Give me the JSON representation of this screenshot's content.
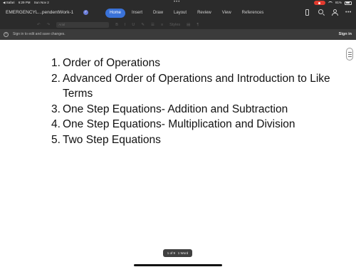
{
  "status_bar": {
    "app": "◀ Safari",
    "time": "6:29 PM",
    "date": "Sun Nov 2",
    "battery": "81%"
  },
  "title_bar": {
    "doc_title": "EMERGENCYL...pendentWork-1",
    "tabs": [
      "Home",
      "Insert",
      "Draw",
      "Layout",
      "Review",
      "View",
      "References"
    ],
    "active_tab": "Home"
  },
  "toolbar": {
    "font_name": "Arial",
    "bold": "B",
    "italic": "I",
    "underline": "U",
    "styles": "Styles"
  },
  "banner": {
    "message": "Sign in to edit and save changes.",
    "sign_in": "Sign in"
  },
  "document": {
    "items": [
      {
        "num": "1.",
        "text": "Order of Operations"
      },
      {
        "num": "2.",
        "text": "Advanced Order of Operations and Introduction to Like Terms"
      },
      {
        "num": "3.",
        "text": "One Step Equations- Addition and Subtraction"
      },
      {
        "num": "4.",
        "text": "One Step Equations- Multiplication and Division"
      },
      {
        "num": "5.",
        "text": "Two Step Equations"
      }
    ]
  },
  "page_count": {
    "label": "1 of 9",
    "words": "1 Word"
  },
  "colors": {
    "accent": "#3a72d8",
    "chrome": "#2b2b2b",
    "banner": "#3b3b3b",
    "record": "#e23b2f"
  }
}
